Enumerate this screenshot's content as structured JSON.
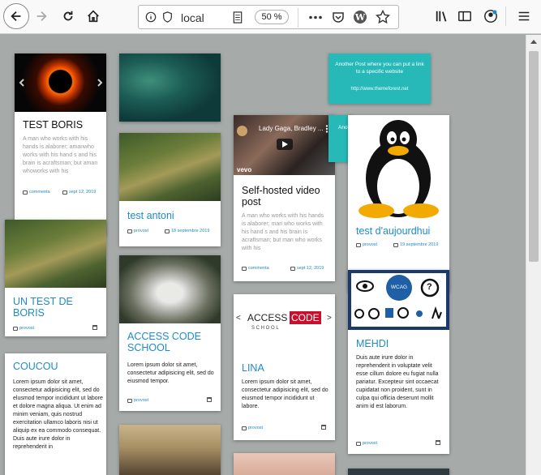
{
  "browser": {
    "url": "local",
    "zoom": "50 %"
  },
  "cards": {
    "c1": {
      "title": "TEST BORIS",
      "excerpt": "A man who works with his hands is alaborer; amanwho works with his hand s and his brain is acraftsman; but aman whoworks with his",
      "comment_label": "commenta",
      "date": "sept 12, 2019"
    },
    "c2": {
      "title": "UN TEST DE BORIS",
      "author": "provost"
    },
    "c3": {
      "title": "COUCOU",
      "excerpt": "Lorem ipsum dolor sit amet, consectetur adipisicing elit, sed do elusmod tempor incididunt ut labore et dolore magna aliqua. Ut enim ad minim veniam, quis nostrud exercitation ullamco laboris nisi ut aliquip ex ea commodo consequat. Duis aute irure dolor in reprehenderit in"
    },
    "c5": {
      "title": "test antoni",
      "author": "provost",
      "date": "18 septembre 2019"
    },
    "c6": {
      "title": "ACCESS CODE SCHOOL",
      "excerpt": "Lorem ipsum dolor sit amet, consectetur adipisicing elit, sed do eiusmod tempor.",
      "author": "provost"
    },
    "c8": {
      "video_title": "Lady Gaga, Bradley ...",
      "vevo": "vevo",
      "title": "Self-hosted video post",
      "excerpt": "A man who works with his hands is alaborer; man who works with his hand s and his brain is acraftsman; but man who works with his",
      "comment_label": "commenta",
      "date": "sept 12, 2019"
    },
    "c9": {
      "logo_left": "ACCESS",
      "logo_right": "CODE",
      "logo_sub": "S C H O O L",
      "title": "LINA",
      "excerpt": "Lorem ipsum dolor sit amet, consectetur adipisicing elit, sed do eiusmod tempor incididunt ut labore.",
      "author": "provost"
    },
    "c11": {
      "title": "test d'aujourdhui",
      "author": "provost",
      "date": "19 septembre 2019"
    },
    "c12": {
      "wcag": "WCAG",
      "title": "MEHDI",
      "excerpt": "Duis aute irure dolor in reprehenderit in voluptate velit esse cillum dolore eu fugiat nulla pariatur. Excepteur sint occaecat cupidatat non proident, sunt in culpa qui officia deserunt mollit anim id est laborum.",
      "author": "provost"
    }
  },
  "banner": {
    "text": "Another Post where you can put a link to a specific website",
    "link": "http://www.themeforest.net",
    "partial": "Ano"
  },
  "colors": {
    "accent": "#1e8bc9",
    "teal": "#26b9b7",
    "page_bg": "#a6aaa9"
  }
}
